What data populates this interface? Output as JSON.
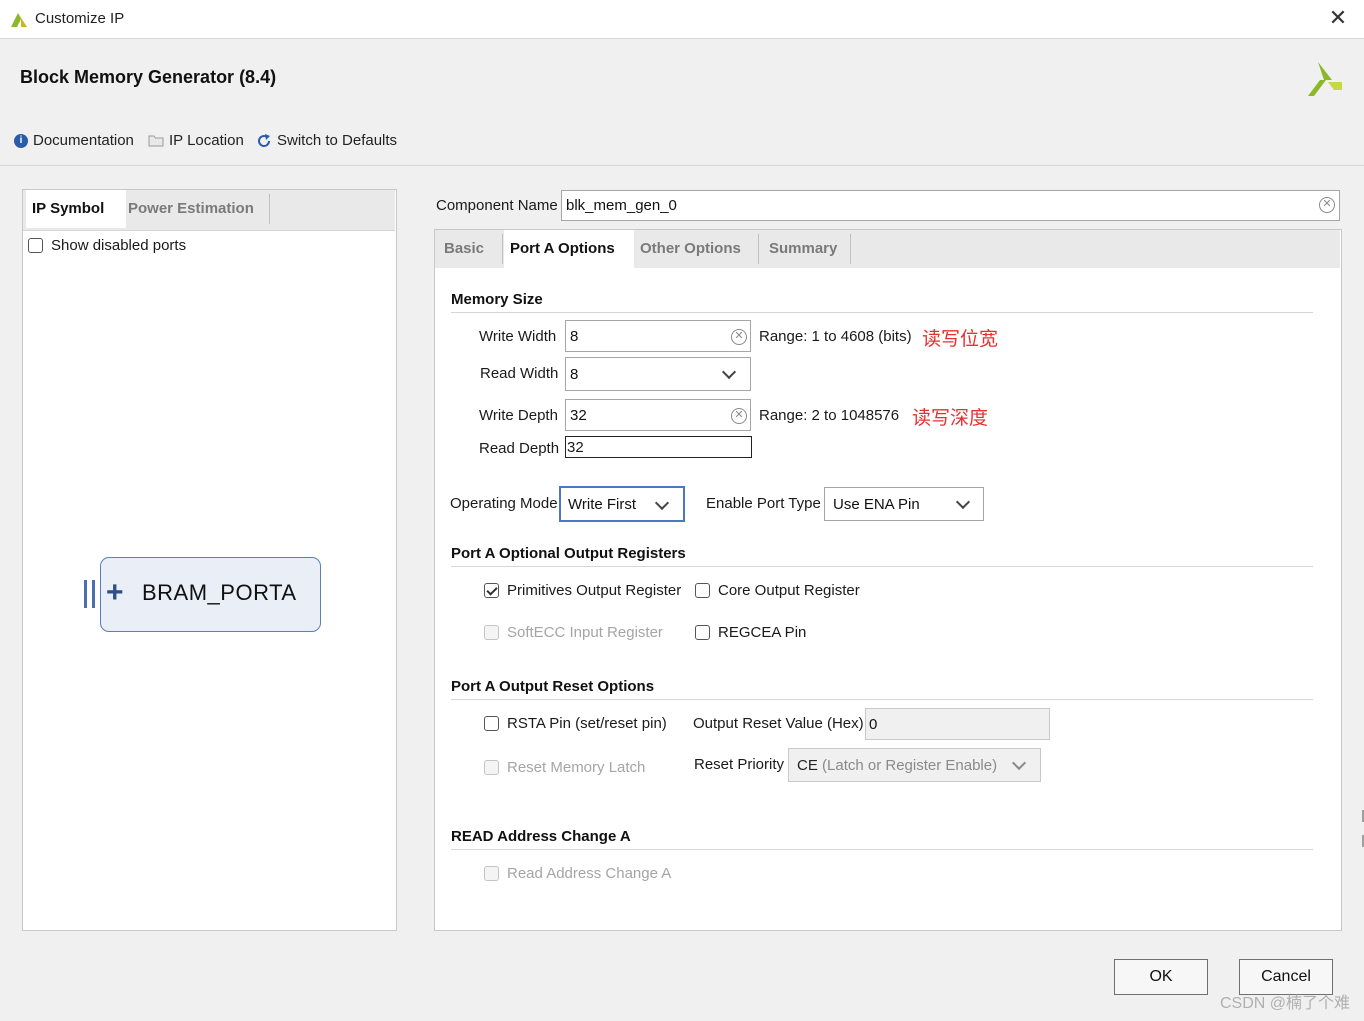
{
  "window": {
    "title": "Customize IP",
    "close_label": "✕"
  },
  "header": {
    "app_title": "Block Memory Generator (8.4)"
  },
  "toolbar": {
    "documentation": "Documentation",
    "ip_location": "IP Location",
    "switch_defaults": "Switch to Defaults"
  },
  "left_panel": {
    "tabs": [
      "IP Symbol",
      "Power Estimation"
    ],
    "show_disabled_ports": "Show disabled ports",
    "symbol": {
      "expand": "+",
      "name": "BRAM_PORTA"
    }
  },
  "component": {
    "label": "Component Name",
    "value": "blk_mem_gen_0"
  },
  "tabs": [
    "Basic",
    "Port A Options",
    "Other Options",
    "Summary"
  ],
  "memory_size": {
    "title": "Memory Size",
    "write_width": {
      "label": "Write Width",
      "value": "8",
      "range": "Range: 1 to 4608 (bits)",
      "annotation": "读写位宽"
    },
    "read_width": {
      "label": "Read Width",
      "value": "8"
    },
    "write_depth": {
      "label": "Write Depth",
      "value": "32",
      "range": "Range: 2 to 1048576",
      "annotation": "读写深度"
    },
    "read_depth": {
      "label": "Read Depth",
      "value": "32"
    }
  },
  "operating_mode": {
    "label": "Operating Mode",
    "value": "Write First"
  },
  "enable_port_type": {
    "label": "Enable Port Type",
    "value": "Use ENA Pin"
  },
  "optional_registers": {
    "title": "Port A Optional Output Registers",
    "primitives": {
      "label": "Primitives Output Register",
      "checked": true
    },
    "core": {
      "label": "Core Output Register",
      "checked": false
    },
    "softecc": {
      "label": "SoftECC Input Register",
      "checked": false
    },
    "regcea": {
      "label": "REGCEA Pin",
      "checked": false
    }
  },
  "reset_options": {
    "title": "Port A Output Reset Options",
    "rsta": {
      "label": "RSTA Pin (set/reset pin)",
      "checked": false
    },
    "reset_value": {
      "label": "Output Reset Value (Hex)",
      "value": "0"
    },
    "reset_latch": {
      "label": "Reset Memory Latch",
      "checked": false
    },
    "priority": {
      "label": "Reset Priority",
      "value_prefix": "CE",
      "value_rest": " (Latch or Register Enable)"
    }
  },
  "read_address": {
    "title": "READ Address Change A",
    "checkbox": "Read Address Change A"
  },
  "buttons": {
    "ok": "OK",
    "cancel": "Cancel"
  },
  "watermark": "CSDN @楠了个难",
  "colors": {
    "accent": "#4a78c2",
    "annotation": "#e53030",
    "logo": "#8ab826"
  }
}
